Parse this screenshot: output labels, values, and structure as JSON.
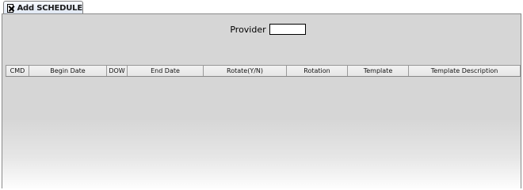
{
  "tab": {
    "label": "Add SCHEDULE"
  },
  "form": {
    "provider_label": "Provider",
    "provider_value": ""
  },
  "table": {
    "columns": [
      "CMD",
      "Begin Date",
      "DOW",
      "End Date",
      "Rotate(Y/N)",
      "Rotation",
      "Template",
      "Template Description"
    ],
    "rows": []
  },
  "icons": {
    "tab_close": "close-icon"
  }
}
